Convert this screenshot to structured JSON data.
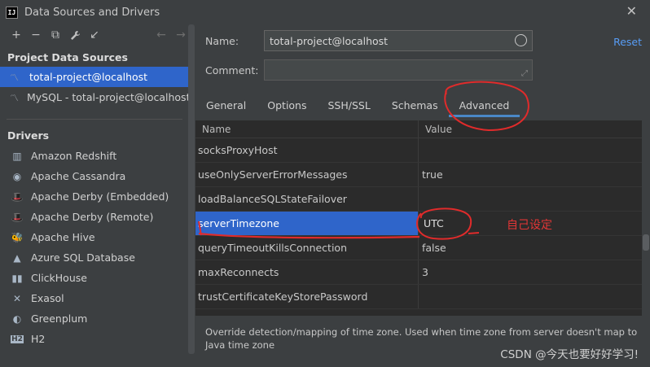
{
  "window": {
    "logo_text": "IJ",
    "title": "Data Sources and Drivers",
    "close_symbol": "✕"
  },
  "toolbar": {
    "add_symbol": "+",
    "remove_symbol": "−",
    "copy_symbol": "⧉",
    "wrench_symbol": "🔧",
    "import_symbol": "↙",
    "back_symbol": "←",
    "forward_symbol": "→"
  },
  "sidebar": {
    "project_section_title": "Project Data Sources",
    "data_sources": [
      {
        "label": "total-project@localhost",
        "icon": "datasource-icon"
      },
      {
        "label": "MySQL - total-project@localhost",
        "icon": "datasource-icon"
      }
    ],
    "drivers_section_title": "Drivers",
    "drivers": [
      {
        "label": "Amazon Redshift",
        "icon": "redshift-icon",
        "glyph": "▥"
      },
      {
        "label": "Apache Cassandra",
        "icon": "cassandra-icon",
        "glyph": "◉"
      },
      {
        "label": "Apache Derby (Embedded)",
        "icon": "derby-icon",
        "glyph": "🎩"
      },
      {
        "label": "Apache Derby (Remote)",
        "icon": "derby-icon",
        "glyph": "🎩"
      },
      {
        "label": "Apache Hive",
        "icon": "hive-icon",
        "glyph": "🐝"
      },
      {
        "label": "Azure SQL Database",
        "icon": "azure-icon",
        "glyph": "▲"
      },
      {
        "label": "ClickHouse",
        "icon": "clickhouse-icon",
        "glyph": "▮▮"
      },
      {
        "label": "Exasol",
        "icon": "exasol-icon",
        "glyph": "✕"
      },
      {
        "label": "Greenplum",
        "icon": "greenplum-icon",
        "glyph": "◐"
      },
      {
        "label": "H2",
        "icon": "h2-icon",
        "glyph": "H2"
      }
    ]
  },
  "form": {
    "name_label": "Name:",
    "name_value": "total-project@localhost",
    "comment_label": "Comment:",
    "comment_value": "",
    "expand_symbol": "⤢",
    "reset_label": "Reset"
  },
  "tabs": [
    {
      "label": "General",
      "active": false
    },
    {
      "label": "Options",
      "active": false
    },
    {
      "label": "SSH/SSL",
      "active": false
    },
    {
      "label": "Schemas",
      "active": false
    },
    {
      "label": "Advanced",
      "active": true
    }
  ],
  "table": {
    "headers": {
      "name": "Name",
      "value": "Value"
    },
    "rows": [
      {
        "name": "socksProxyHost",
        "value": ""
      },
      {
        "name": "useOnlyServerErrorMessages",
        "value": "true"
      },
      {
        "name": "loadBalanceSQLStateFailover",
        "value": ""
      },
      {
        "name": "serverTimezone",
        "value": "UTC"
      },
      {
        "name": "queryTimeoutKillsConnection",
        "value": "false"
      },
      {
        "name": "maxReconnects",
        "value": "3"
      },
      {
        "name": "trustCertificateKeyStorePassword",
        "value": ""
      }
    ],
    "selected_row": 3
  },
  "description": "Override detection/mapping of time zone. Used when time zone from server doesn't map to Java time zone",
  "annotation": {
    "text": "自己设定",
    "color": "#e33636"
  },
  "watermark": "CSDN @今天也要好好学习!",
  "colors": {
    "selection": "#2f65ca",
    "link": "#589df6",
    "tab_underline": "#4a88c7"
  }
}
